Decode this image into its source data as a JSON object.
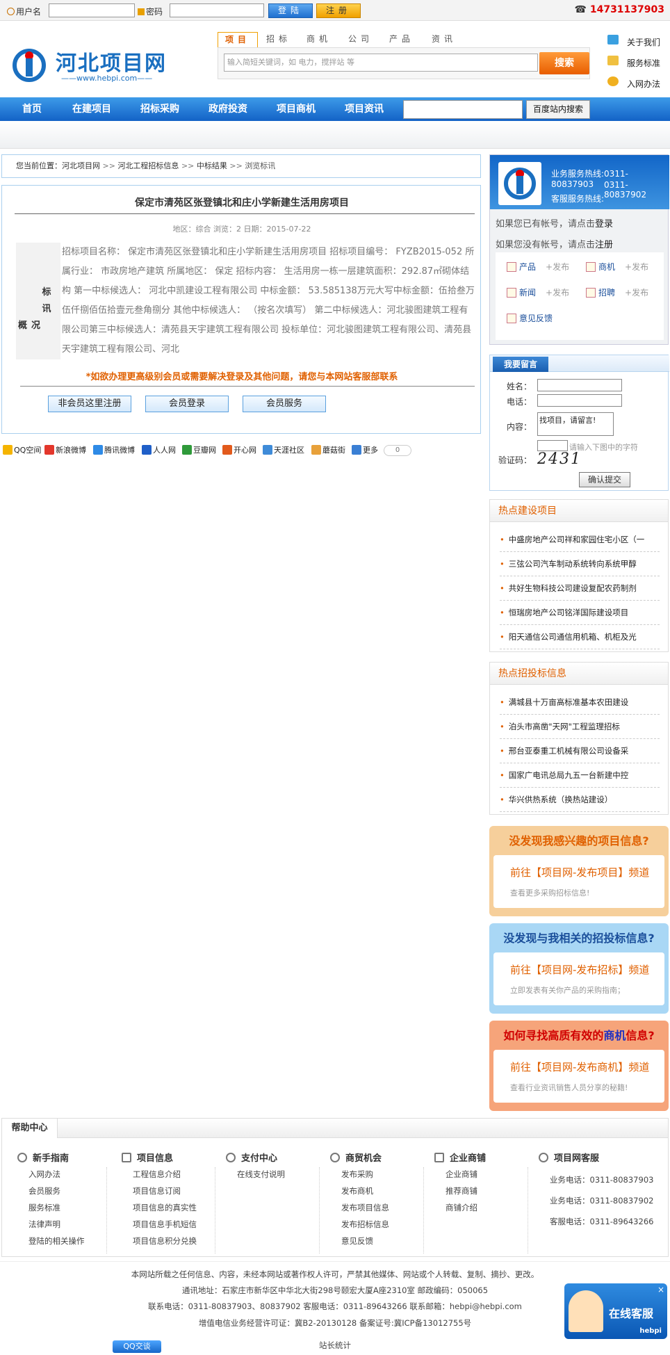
{
  "topbar": {
    "username_label": "用户名",
    "password_label": "密码",
    "login_button": "登陆",
    "register_button": "注册",
    "hotline": "14731137903"
  },
  "header": {
    "logo_text": "河北项目网",
    "logo_url": "www.hebpi.com",
    "search_tabs": [
      "项目",
      "招标",
      "商机",
      "公司",
      "产品",
      "资讯"
    ],
    "search_placeholder": "输入简短关键词，如 电力，搅拌站 等",
    "search_button": "搜索",
    "links": [
      "关于我们",
      "服务标准",
      "入网办法"
    ]
  },
  "nav": {
    "items": [
      "首页",
      "在建项目",
      "招标采购",
      "政府投资",
      "项目商机",
      "项目资讯"
    ],
    "site_search_button": "百度站内搜索"
  },
  "breadcrumb": {
    "prefix": "您当前位置：",
    "items": [
      "河北项目网",
      "河北工程招标信息",
      "中标结果",
      "浏览标讯"
    ],
    "sep": ">>"
  },
  "article": {
    "title": "保定市清苑区张登镇北和庄小学新建生活用房项目",
    "meta": "地区：综合 浏览：2 日期：2015-07-22",
    "side_label_1": "标讯",
    "side_label_2": "概况",
    "body": "招标项目名称：  保定市清苑区张登镇北和庄小学新建生活用房项目 招标项目编号：  FYZB2015-052 所属行业：  市政房地产建筑 所属地区：  保定 招标内容：  生活用房一栋一层建筑面积：292.87㎡砌体结构 第一中标候选人：  河北中凯建设工程有限公司 中标金额：  53.585138万元大写中标金额：伍拾叁万伍仟捌佰伍拾壹元叁角捌分 其他中标候选人：  （按名次填写）  第二中标候选人：河北骏图建筑工程有限公司第三中标候选人：清苑县天宇建筑工程有限公司 投标单位：河北骏图建筑工程有限公司、清苑县天宇建筑工程有限公司、河北",
    "notice": "*如欲办理更高级别会员或需要解决登录及其他问题，请您与本网站客服部联系",
    "buttons": [
      "非会员这里注册",
      "会员登录",
      "会员服务"
    ]
  },
  "share": {
    "items": [
      "QQ空间",
      "新浪微博",
      "腾讯微博",
      "人人网",
      "豆瓣网",
      "开心网",
      "天涯社区",
      "蘑菇街",
      "更多"
    ],
    "count": "0",
    "colors": [
      "#f5b400",
      "#e3372c",
      "#2e8ae6",
      "#1f5fc8",
      "#2f9a3a",
      "#e25a1c",
      "#3f8bd8",
      "#e8a13a",
      "#3a7fd4"
    ]
  },
  "member": {
    "hotline_1": "业务服务热线:0311-80837903",
    "hotline_2": "0311-80837902",
    "service_label": "客服服务热线:",
    "line_login_pre": "如果您已有帐号，请点击",
    "line_login": "登录",
    "line_reg_pre": "如果您没有帐号，请点击",
    "line_reg": "注册",
    "grid": [
      {
        "label": "产品",
        "publish": "+发布"
      },
      {
        "label": "商机",
        "publish": "+发布"
      },
      {
        "label": "新闻",
        "publish": "+发布"
      },
      {
        "label": "招聘",
        "publish": "+发布"
      },
      {
        "label": "意见反馈",
        "publish": ""
      }
    ]
  },
  "message": {
    "title": "我要留言",
    "name_label": "姓名：",
    "phone_label": "电话：",
    "content_label": "内容：",
    "content_value": "找项目，请留言!",
    "captcha_label": "验证码：",
    "captcha_tip": "请输入下图中的字符",
    "captcha_text": "2431",
    "submit": "确认提交"
  },
  "hot_projects": {
    "title": "热点建设项目",
    "items": [
      "中盛房地产公司祥和家园住宅小区（一",
      "三弦公司汽车制动系统转向系统甲醇",
      "共好生物科技公司建设复配农药制剂",
      "恒瑞房地产公司铭洋国际建设项目",
      "阳天通信公司通信用机箱、机柜及光"
    ]
  },
  "hot_bids": {
    "title": "热点招投标信息",
    "items": [
      "满城县十万亩高标准基本农田建设",
      "泊头市高凿\"天网\"工程监理招标",
      "邢台亚泰重工机械有限公司设备采",
      "国家广电讯总局九五一台新建中控",
      "华兴供热系统（换热站建设）"
    ]
  },
  "promos": [
    {
      "title": "没发现我感兴趣的项目信息?",
      "link": "前往【项目网-发布项目】频道",
      "sub": "查看更多采购招标信息!",
      "bg": "#f6cf9b",
      "title_color": "#e06000"
    },
    {
      "title": "没发现与我相关的招投标信息?",
      "link": "前往【项目网-发布招标】频道",
      "sub": "立即发表有关你产品的采购指南；",
      "bg": "#a9d7f5",
      "title_color": "#1a4e9a"
    },
    {
      "title_pre": "如何寻找高质有效的",
      "title_mid": "商机",
      "title_post": "信息?",
      "link": "前往【项目网-发布商机】频道",
      "sub": "查看行业资讯销售人员分享的秘籍!",
      "bg": "#f6a47a",
      "title_color": "#d00000",
      "mid_color": "#2030c0"
    }
  ],
  "help": {
    "tab": "帮助中心",
    "columns": [
      {
        "title": "新手指南",
        "links": [
          "入网办法",
          "会员服务",
          "服务标准",
          "法律声明",
          "登陆的相关操作"
        ]
      },
      {
        "title": "项目信息",
        "links": [
          "工程信息介绍",
          "项目信息订阅",
          "项目信息的真实性",
          "项目信息手机短信",
          "项目信息积分兑换"
        ]
      },
      {
        "title": "支付中心",
        "links": [
          "在线支付说明"
        ]
      },
      {
        "title": "商贸机会",
        "links": [
          "发布采购",
          "发布商机",
          "发布项目信息",
          "发布招标信息",
          "意见反馈"
        ]
      },
      {
        "title": "企业商铺",
        "links": [
          "企业商铺",
          "推荐商铺",
          "商铺介绍"
        ]
      },
      {
        "title": "项目网客服",
        "links": [
          "业务电话：0311-80837903",
          "业务电话：0311-80837902",
          "客服电话：0311-89643266"
        ]
      }
    ]
  },
  "footer": {
    "lines": [
      "本网站所载之任何信息、内容，未经本网站或著作权人许可，严禁其他媒体、网站或个人转载、复制、摘抄、更改。",
      "通讯地址：石家庄市新华区中华北大街298号颐宏大厦A座2310室 邮政编码：050065",
      "联系电话：0311-80837903、80837902 客服电话：0311-89643266 联系邮箱：hebpi@hebpi.com",
      "增值电信业务经营许可证：冀B2-20130128 备案证号:冀ICP备13012755号",
      "站长统计"
    ],
    "qq_button": "QQ交谈",
    "kefu_title": "在线客服",
    "kefu_brand": "hebpi"
  }
}
